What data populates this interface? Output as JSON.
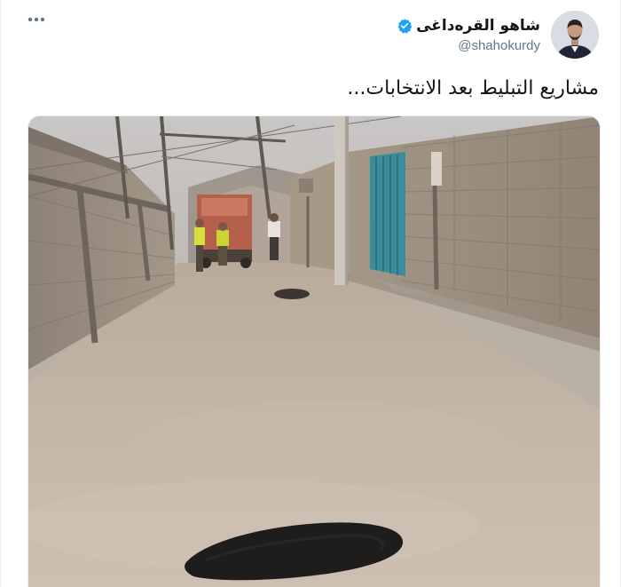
{
  "tweet": {
    "author": {
      "display_name": "شاهو القرەداغی",
      "handle": "@shahokurdy",
      "verified": true
    },
    "text": "مشاريع التبليط بعد الانتخابات...",
    "more_icon": "more-horizontal-icon",
    "verified_icon": "verified-badge-icon",
    "media": {
      "type": "photo",
      "alt": "Dirt alley with a fresh asphalt patch and workers next to a truck"
    }
  },
  "colors": {
    "text_primary": "#14171a",
    "text_secondary": "#657786",
    "verified_blue": "#1da1f2",
    "border": "#e6ecf0"
  }
}
